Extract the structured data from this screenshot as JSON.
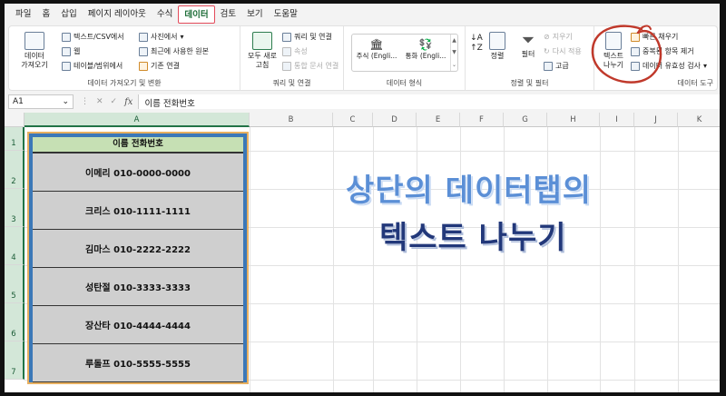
{
  "menu": {
    "tabs": [
      "파일",
      "홈",
      "삽입",
      "페이지 레이아웃",
      "수식",
      "데이터",
      "검토",
      "보기",
      "도움말"
    ],
    "active": "데이터"
  },
  "ribbon": {
    "get_data": {
      "big_button": "데이터\n가져오기",
      "items": [
        "텍스트/CSV에서",
        "웹",
        "테이블/범위에서",
        "사진에서",
        "최근에 사용한 원본",
        "기존 연결"
      ],
      "label": "데이터 가져오기 및 변환"
    },
    "queries": {
      "big_button": "모두 새로\n고침",
      "items": [
        "쿼리 및 연결",
        "속성",
        "통합 문서 연결"
      ],
      "label": "쿼리 및 연결"
    },
    "data_types": {
      "items": [
        "주식 (Engli...",
        "통화 (Engli..."
      ],
      "label": "데이터 형식"
    },
    "sort_filter": {
      "sort_label": "정렬",
      "filter_label": "필터",
      "items": [
        "지우기",
        "다시 적용",
        "고급"
      ],
      "label": "정렬 및 필터"
    },
    "data_tools": {
      "big_button": "텍스트\n나누기",
      "items": [
        "빠른 채우기",
        "중복된 항목 제거",
        "데이터 유효성 검사"
      ],
      "label": "데이터 도구"
    }
  },
  "formula_bar": {
    "name_box": "A1",
    "fx": "fx",
    "content": "이름 전화번호"
  },
  "columns": [
    "A",
    "B",
    "C",
    "D",
    "E",
    "F",
    "G",
    "H",
    "I",
    "J",
    "K"
  ],
  "rows": [
    "1",
    "2",
    "3",
    "4",
    "5",
    "6",
    "7"
  ],
  "table": {
    "header": "이름 전화번호",
    "cells": [
      "이메리 010-0000-0000",
      "크리스 010-1111-1111",
      "김마스 010-2222-2222",
      "성탄절 010-3333-3333",
      "장산타 010-4444-4444",
      "루돌프 010-5555-5555"
    ]
  },
  "overlay": {
    "line1": "상단의 데이터탭의",
    "line2": "텍스트 나누기",
    "line1_color": "#5b8fd6",
    "line2_color": "#22387a",
    "annotation_color": "#c0392b"
  }
}
